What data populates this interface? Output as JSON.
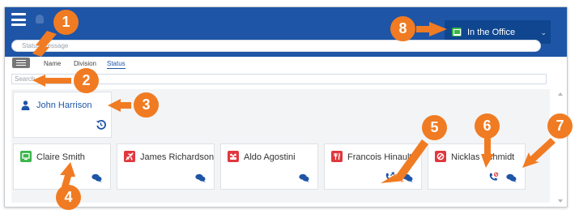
{
  "header": {
    "status_placeholder": "Status message",
    "presence_label": "In the Office",
    "presence_color": "#3bb54a",
    "brand_color": "#1e55a6"
  },
  "tabs": [
    {
      "label": "Name"
    },
    {
      "label": "Division"
    },
    {
      "label": "Status",
      "active": true
    }
  ],
  "search": {
    "placeholder": "Search"
  },
  "current_user": {
    "name": "John Harrison",
    "icon": "person-icon",
    "action_icon": "history-icon"
  },
  "contacts": [
    {
      "name": "Claire Smith",
      "status": "in-office",
      "status_color": "#3bb54a",
      "icon": "monitor-icon",
      "actions": [
        "chat-icon"
      ]
    },
    {
      "name": "James Richardson",
      "status": "travelling",
      "status_color": "#e0383e",
      "icon": "airplane-icon",
      "actions": [
        "chat-icon"
      ]
    },
    {
      "name": "Aldo Agostini",
      "status": "meeting",
      "status_color": "#e0383e",
      "icon": "meeting-icon",
      "actions": [
        "chat-icon"
      ]
    },
    {
      "name": "Francois Hinault",
      "status": "lunch",
      "status_color": "#e0383e",
      "icon": "lunch-icon",
      "actions": [
        "call-forward-icon",
        "chat-icon"
      ]
    },
    {
      "name": "Nicklas Schmidt",
      "status": "do-not-disturb",
      "status_color": "#e0383e",
      "icon": "no-entry-icon",
      "actions": [
        "call-blocked-icon",
        "chat-icon"
      ]
    }
  ],
  "callouts": [
    "1",
    "2",
    "3",
    "4",
    "5",
    "6",
    "7",
    "8"
  ]
}
